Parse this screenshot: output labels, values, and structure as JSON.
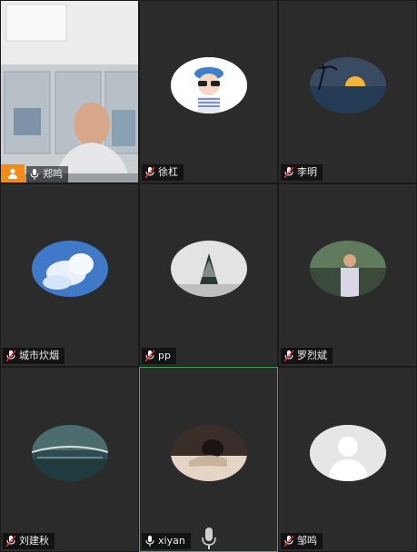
{
  "participants": [
    {
      "name": "郑鸣",
      "type": "camera",
      "host": true
    },
    {
      "name": "徐杠",
      "type": "avatar",
      "avatar": "cartoon-girl"
    },
    {
      "name": "李明",
      "type": "avatar",
      "avatar": "sunset-palm"
    },
    {
      "name": "城市炊烟",
      "type": "avatar",
      "avatar": "clouds-sky"
    },
    {
      "name": "pp",
      "type": "avatar",
      "avatar": "snow-tree"
    },
    {
      "name": "罗烈斌",
      "type": "avatar",
      "avatar": "man-portrait"
    },
    {
      "name": "刘建秋",
      "type": "avatar",
      "avatar": "lake-bridge"
    },
    {
      "name": "xiyan",
      "type": "avatar",
      "avatar": "person-desk",
      "active_speaker": true
    },
    {
      "name": "邹鸣",
      "type": "avatar",
      "avatar": "default-silhouette"
    }
  ],
  "colors": {
    "tile_bg": "#2b2b2c",
    "active_border": "#33b25a",
    "host_badge": "#f28a1a"
  },
  "icons": [
    "mic-icon",
    "mic-muted-icon",
    "person-icon"
  ]
}
